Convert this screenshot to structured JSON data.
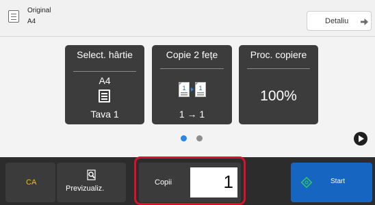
{
  "header": {
    "original_label": "Original",
    "original_size": "A4",
    "detail_button": "Detaliu"
  },
  "cards": {
    "paper": {
      "title": "Select. hârtie",
      "size": "A4",
      "tray": "Tava 1"
    },
    "duplex": {
      "title": "Copie 2 fețe",
      "mode": "1 → 1"
    },
    "ratio": {
      "title": "Proc. copiere",
      "value": "100%"
    }
  },
  "pager": {
    "pages": 2,
    "current": 1
  },
  "footer": {
    "ca_label": "CA",
    "preview_label": "Previzualiz.",
    "copies_label": "Copii",
    "copies_value": "1",
    "start_label": "Start"
  },
  "colors": {
    "accent_blue": "#1665c0",
    "ca_yellow": "#f3c300",
    "highlight_red": "#d8112d",
    "start_icon_green": "#2fc46a"
  },
  "icons": {
    "original": "document-icon",
    "detail": "arrow-right-icon",
    "tray": "paper-tray-icon",
    "duplex": "duplex-copy-icon",
    "next": "next-page-icon",
    "preview": "preview-magnifier-icon",
    "start": "start-diamond-icon"
  }
}
